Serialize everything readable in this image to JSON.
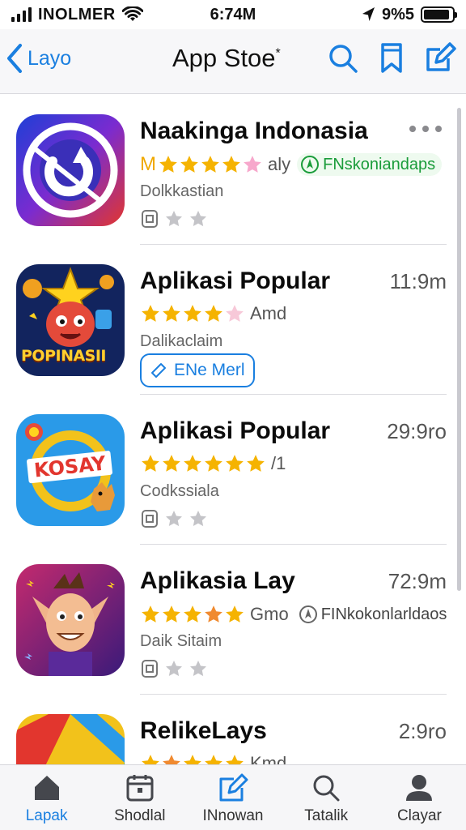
{
  "status_bar": {
    "carrier": "INOLMER",
    "time": "6:74M",
    "battery": "9%5",
    "battery_level": 0.92
  },
  "nav": {
    "back_label": "Layo",
    "title": "App Stoe",
    "title_mark": "*",
    "icons": [
      "search-icon",
      "bookmark-icon",
      "compose-icon"
    ]
  },
  "apps": [
    {
      "name": "Naakinga Indonasia",
      "rating_prefix": "M",
      "rating_extra": "aly",
      "badge": "FNskoniandaps",
      "subtitle": "Dolkkastian",
      "has_more_menu": true,
      "icon": "refresh-logo-icon"
    },
    {
      "name": "Aplikasi Popular",
      "right_text": "11:9m",
      "rating_extra": "Amd",
      "subtitle": "Dalikaclaim",
      "action_label": "ENe Merl",
      "icon": "game-character-icon",
      "icon_text": "POPINASII"
    },
    {
      "name": "Aplikasi Popular",
      "right_text": "29:9ro",
      "rating_extra": "/1",
      "subtitle": "Codkssiala",
      "icon": "kosay-game-icon",
      "icon_text": "KOSAY"
    },
    {
      "name": "Aplikasia Lay",
      "right_text": "72:9m",
      "rating_extra": "Gmo",
      "badge": "FINkokonlarldaos",
      "subtitle": "Daik Sitaim",
      "icon": "goblin-character-icon"
    },
    {
      "name": "RelikeLays",
      "right_text": "2:9ro",
      "rating_extra": "Kmd",
      "icon": "rainbow-logo-icon"
    }
  ],
  "tabs": [
    {
      "label": "Lapak",
      "icon": "home-icon",
      "active": true
    },
    {
      "label": "Shodlal",
      "icon": "calendar-icon",
      "active": false
    },
    {
      "label": "INnowan",
      "icon": "edit-icon",
      "active": false
    },
    {
      "label": "Tatalik",
      "icon": "search-icon",
      "active": false
    },
    {
      "label": "Clayar",
      "icon": "person-icon",
      "active": false
    }
  ],
  "colors": {
    "accent": "#1a7fe0",
    "star": "#f5b301",
    "badge_green": "#1a9c3a"
  }
}
